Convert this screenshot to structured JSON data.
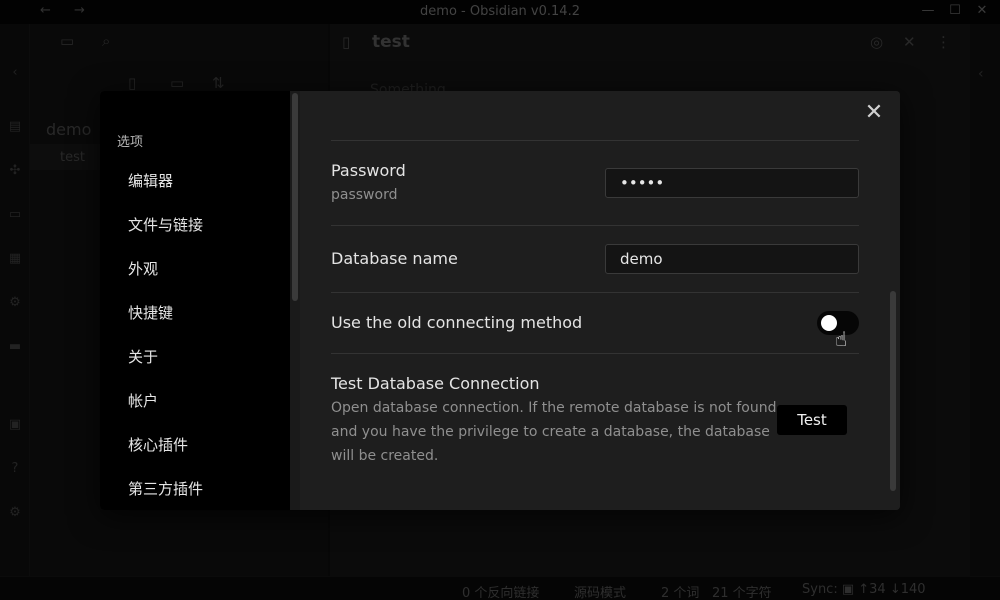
{
  "window": {
    "title": "demo - Obsidian v0.14.2",
    "nav_back": "←",
    "nav_forward": "→",
    "min_glyph": "—",
    "max_glyph": "☐",
    "close_glyph": "✕"
  },
  "explorer": {
    "vault_name": "demo",
    "files": [
      "test"
    ]
  },
  "editor": {
    "tab_title": "test",
    "ghost_text": "Something..."
  },
  "statusbar": {
    "backlinks": "0 个反向链接",
    "mode": "源码模式",
    "words": "2 个词",
    "chars": "21 个字符",
    "sync": "Sync: ▣ ↑34 ↓140"
  },
  "settings": {
    "sidebar_heading": "选项",
    "nav_items": [
      "编辑器",
      "文件与链接",
      "外观",
      "快捷键",
      "关于",
      "帐户",
      "核心插件",
      "第三方插件"
    ],
    "close_glyph": "✕",
    "password": {
      "name": "Password",
      "desc": "password",
      "value": "•••••"
    },
    "database_name": {
      "name": "Database name",
      "value": "demo"
    },
    "old_connecting": {
      "name": "Use the old connecting method",
      "enabled": false
    },
    "test_connection": {
      "name": "Test Database Connection",
      "desc_lines": [
        "Open database connection. If the remote database is not found",
        "and you have the privilege to create a database, the database",
        "will be created."
      ],
      "button_label": "Test"
    }
  }
}
